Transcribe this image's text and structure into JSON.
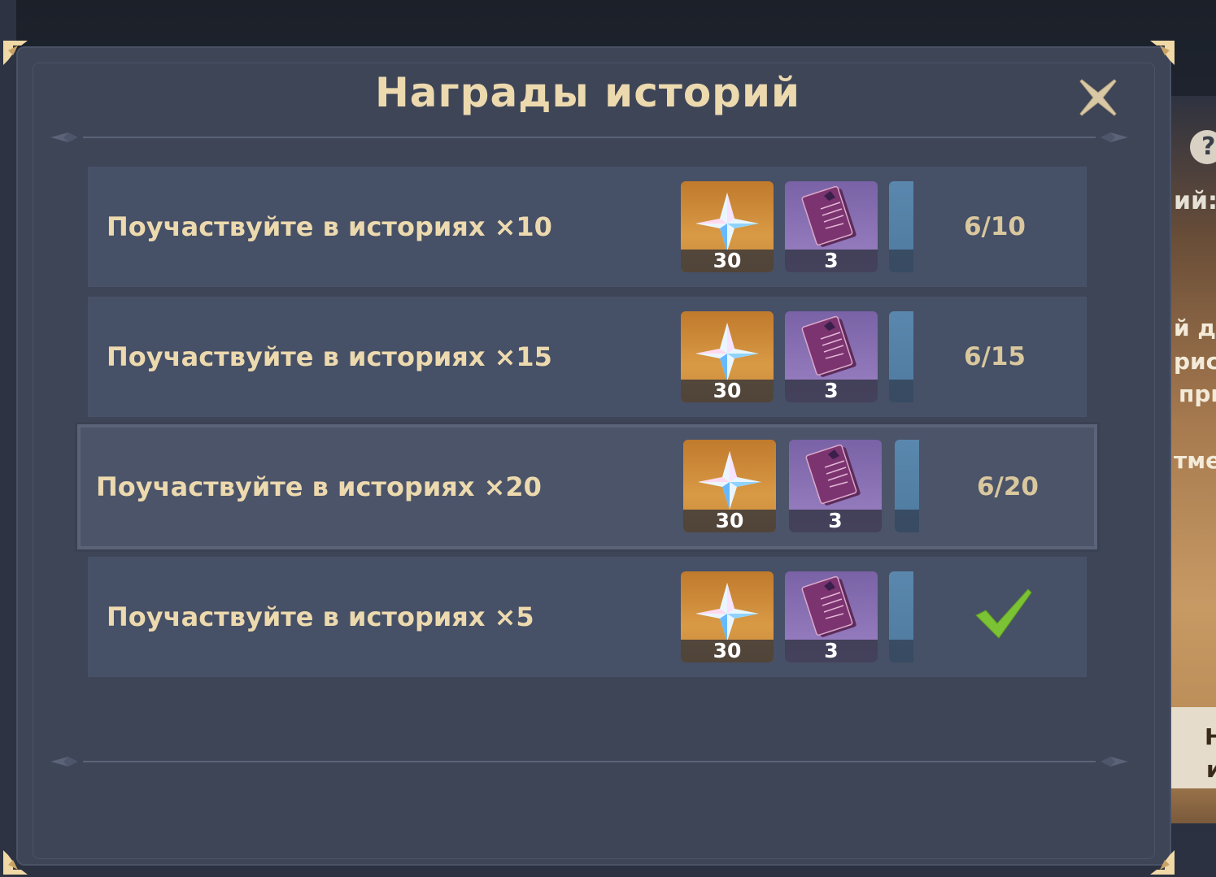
{
  "dialog": {
    "title": "Награды историй"
  },
  "background": {
    "help_symbol": "?",
    "text_fragments": [
      "ий:",
      "й де",
      "рис",
      "при",
      "тме",
      "Н",
      "и"
    ]
  },
  "rows": [
    {
      "label": "Поучаствуйте в историях ×10",
      "progress": "6/10",
      "completed": false,
      "rewards": [
        {
          "icon": "primogem-icon",
          "count": "30"
        },
        {
          "icon": "book-icon",
          "count": "3"
        },
        {
          "icon": "partial-reward-icon",
          "count": ""
        }
      ]
    },
    {
      "label": "Поучаствуйте в историях ×15",
      "progress": "6/15",
      "completed": false,
      "rewards": [
        {
          "icon": "primogem-icon",
          "count": "30"
        },
        {
          "icon": "book-icon",
          "count": "3"
        },
        {
          "icon": "partial-reward-icon",
          "count": ""
        }
      ]
    },
    {
      "label": "Поучаствуйте в историях ×20",
      "progress": "6/20",
      "completed": false,
      "rewards": [
        {
          "icon": "primogem-icon",
          "count": "30"
        },
        {
          "icon": "book-icon",
          "count": "3"
        },
        {
          "icon": "partial-reward-icon",
          "count": ""
        }
      ]
    },
    {
      "label": "Поучаствуйте в историях ×5",
      "progress": "",
      "completed": true,
      "rewards": [
        {
          "icon": "primogem-icon",
          "count": "30"
        },
        {
          "icon": "book-icon",
          "count": "3"
        },
        {
          "icon": "partial-reward-icon",
          "count": ""
        }
      ]
    }
  ],
  "colors": {
    "title": "#ecd9ae",
    "panel": "#3e4557",
    "row": "#465066",
    "check": "#7bc234",
    "gold_tile": "#d99a45",
    "purple_tile": "#9a82c4"
  }
}
